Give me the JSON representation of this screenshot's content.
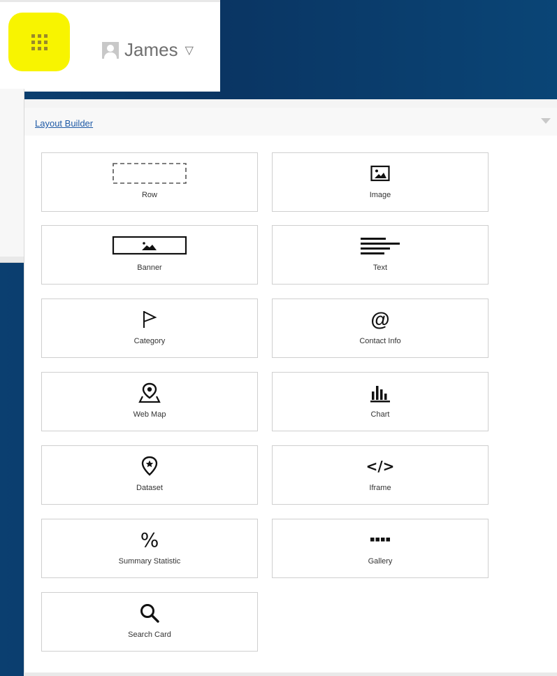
{
  "header": {
    "user_name": "James"
  },
  "builder": {
    "title": "Layout Builder",
    "cards": [
      {
        "label": "Row",
        "icon": "row-placeholder-icon"
      },
      {
        "label": "Image",
        "icon": "image-icon"
      },
      {
        "label": "Banner",
        "icon": "banner-icon"
      },
      {
        "label": "Text",
        "icon": "text-align-left-icon"
      },
      {
        "label": "Category",
        "icon": "flag-icon"
      },
      {
        "label": "Contact Info",
        "icon": "at-sign-icon"
      },
      {
        "label": "Web Map",
        "icon": "map-pin-icon"
      },
      {
        "label": "Chart",
        "icon": "bar-chart-icon"
      },
      {
        "label": "Dataset",
        "icon": "dataset-pin-icon"
      },
      {
        "label": "Iframe",
        "icon": "code-icon"
      },
      {
        "label": "Summary Statistic",
        "icon": "percent-icon"
      },
      {
        "label": "Gallery",
        "icon": "gallery-dots-icon"
      },
      {
        "label": "Search Card",
        "icon": "search-icon"
      }
    ]
  }
}
